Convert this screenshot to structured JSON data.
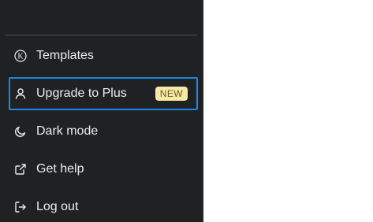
{
  "menu": {
    "items": [
      {
        "id": "templates",
        "label": "Templates",
        "icon": "k-circle-icon"
      },
      {
        "id": "upgrade",
        "label": "Upgrade to Plus",
        "icon": "user-icon",
        "badge": "NEW"
      },
      {
        "id": "dark-mode",
        "label": "Dark mode",
        "icon": "moon-icon"
      },
      {
        "id": "get-help",
        "label": "Get help",
        "icon": "external-link-icon"
      },
      {
        "id": "log-out",
        "label": "Log out",
        "icon": "logout-icon"
      }
    ]
  },
  "colors": {
    "background": "#202123",
    "text": "#ececf1",
    "divider": "#4d4d4f",
    "focus_outline": "#1a86e8",
    "badge_bg": "#f6e8a7",
    "badge_text": "#6b5a16"
  }
}
